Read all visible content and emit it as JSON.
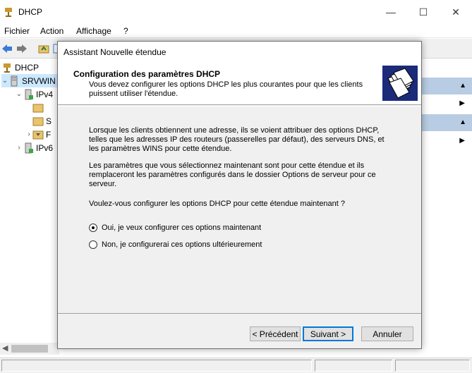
{
  "window": {
    "title": "DHCP",
    "minimize_glyph": "—",
    "maximize_glyph": "☐",
    "close_glyph": "✕"
  },
  "menu": {
    "items": [
      "Fichier",
      "Action",
      "Affichage",
      "?"
    ]
  },
  "tree": {
    "root": "DHCP",
    "server": "SRVWIN",
    "ipv4": "IPv4",
    "ipv6": "IPv6",
    "child_labels": [
      "",
      "S",
      "F"
    ]
  },
  "dialog": {
    "title": "Assistant Nouvelle étendue",
    "heading": "Configuration des paramètres DHCP",
    "subheading": "Vous devez configurer les options DHCP les plus courantes pour que les clients puissent utiliser l'étendue.",
    "paragraph1": "Lorsque les clients obtiennent une adresse, ils se voient attribuer des options DHCP, telles que les adresses IP des routeurs (passerelles par défaut), des serveurs DNS, et les paramètres WINS pour cette étendue.",
    "paragraph2": "Les paramètres que vous sélectionnez maintenant sont pour cette étendue et ils remplaceront les paramètres configurés dans le dossier Options de serveur pour ce serveur.",
    "question": "Voulez-vous configurer les options DHCP pour cette étendue maintenant ?",
    "options": [
      {
        "label": "Oui, je veux configurer ces options maintenant",
        "checked": true
      },
      {
        "label": "Non, je configurerai ces options ultérieurement",
        "checked": false
      }
    ],
    "buttons": {
      "back": "< Précédent",
      "next": "Suivant >",
      "cancel": "Annuler"
    }
  },
  "colors": {
    "accent": "#0078d7",
    "actions_header": "#b8cde4",
    "dialog_bg": "#f0f0f0"
  }
}
